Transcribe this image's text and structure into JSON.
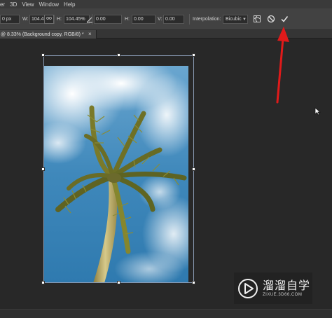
{
  "menubar": {
    "items": [
      "er",
      "3D",
      "View",
      "Window",
      "Help"
    ]
  },
  "options": {
    "x_value": "0 px",
    "w_label": "W:",
    "w_value": "104.45%",
    "link_label": "oo",
    "h_label": "H:",
    "h_value": "104.45%",
    "angle_value": "0.00",
    "hskew_label": "H:",
    "hskew_value": "0.00",
    "vskew_label": "V:",
    "vskew_value": "0.00",
    "interpolation_label": "Interpolation:",
    "interpolation_value": "Bicubic"
  },
  "document_tab": {
    "label": "@ 8.33% (Background copy, RGB/8) *",
    "close": "×"
  },
  "watermark": {
    "title": "溜溜自学",
    "url": "ZIXUE.3D66.COM"
  },
  "colors": {
    "annotation_arrow": "#e01a1a",
    "sky": "#3d86b8",
    "bounding_box": "#8a9bb5"
  }
}
